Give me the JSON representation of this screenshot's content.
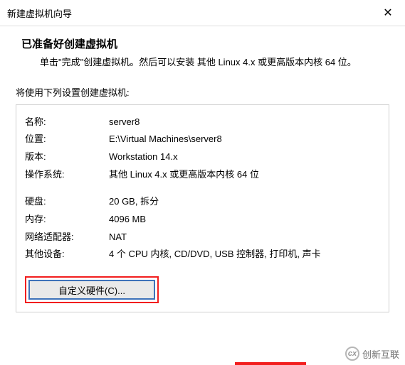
{
  "window": {
    "title": "新建虚拟机向导",
    "close_label": "✕"
  },
  "header": {
    "heading": "已准备好创建虚拟机",
    "subheading": "单击\"完成\"创建虚拟机。然后可以安装 其他 Linux 4.x 或更高版本内核 64 位。"
  },
  "section_label": "将使用下列设置创建虚拟机:",
  "info": {
    "name_label": "名称:",
    "name_value": "server8",
    "location_label": "位置:",
    "location_value": "E:\\Virtual Machines\\server8",
    "version_label": "版本:",
    "version_value": "Workstation 14.x",
    "os_label": "操作系统:",
    "os_value": "其他 Linux 4.x 或更高版本内核 64 位",
    "disk_label": "硬盘:",
    "disk_value": "20 GB, 拆分",
    "memory_label": "内存:",
    "memory_value": "4096 MB",
    "network_label": "网络适配器:",
    "network_value": "NAT",
    "other_label": "其他设备:",
    "other_value": "4 个 CPU 内核, CD/DVD, USB 控制器, 打印机, 声卡"
  },
  "buttons": {
    "customize": "自定义硬件(C)..."
  },
  "watermark": {
    "text": "创新互联"
  }
}
